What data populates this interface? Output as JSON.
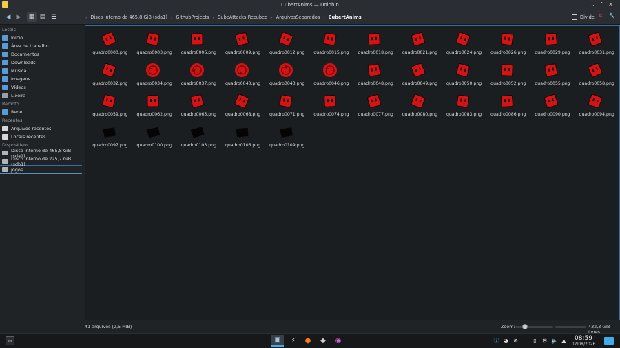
{
  "window": {
    "title": "CubertAnims — Dolphin"
  },
  "toolbar": {
    "back_icon": "arrow-left-icon",
    "forward_icon": "arrow-right-icon",
    "split_label": "Divide",
    "view_modes": [
      "icons-view",
      "compact-view",
      "details-view"
    ]
  },
  "breadcrumb": {
    "items": [
      "Disco interno de 465,8 GiB (sda1)",
      "GithubProjects",
      "CubeAttacks-Recubed",
      "ArquivosSeparados",
      "CubertAnims"
    ]
  },
  "sidebar": {
    "sections": [
      {
        "header": "Locais",
        "items": [
          {
            "label": "Início",
            "icon": "home-folder-icon"
          },
          {
            "label": "Área de trabalho",
            "icon": "desktop-folder-icon"
          },
          {
            "label": "Documentos",
            "icon": "documents-folder-icon"
          },
          {
            "label": "Downloads",
            "icon": "downloads-folder-icon"
          },
          {
            "label": "Música",
            "icon": "music-folder-icon"
          },
          {
            "label": "Imagens",
            "icon": "pictures-folder-icon"
          },
          {
            "label": "Vídeos",
            "icon": "videos-folder-icon"
          },
          {
            "label": "Lixeira",
            "icon": "trash-icon"
          }
        ]
      },
      {
        "header": "Remoto",
        "items": [
          {
            "label": "Rede",
            "icon": "network-icon"
          }
        ]
      },
      {
        "header": "Recentes",
        "items": [
          {
            "label": "Arquivos recentes",
            "icon": "recent-files-icon"
          },
          {
            "label": "Locais recentes",
            "icon": "recent-places-icon"
          }
        ]
      },
      {
        "header": "Dispositivos",
        "items": [
          {
            "label": "Disco interno de 465,8 GiB (sda1)",
            "icon": "drive-icon"
          },
          {
            "label": "Disco interno de 225,7 GiB (sdb1)",
            "icon": "drive-icon"
          },
          {
            "label": "jogos",
            "icon": "drive-icon"
          }
        ]
      }
    ]
  },
  "files": [
    {
      "name": "quadro0000.png",
      "kind": "red"
    },
    {
      "name": "quadro0003.png",
      "kind": "red"
    },
    {
      "name": "quadro0006.png",
      "kind": "red"
    },
    {
      "name": "quadro0009.png",
      "kind": "red"
    },
    {
      "name": "quadro0012.png",
      "kind": "red"
    },
    {
      "name": "quadro0015.png",
      "kind": "red"
    },
    {
      "name": "quadro0018.png",
      "kind": "red"
    },
    {
      "name": "quadro0021.png",
      "kind": "red"
    },
    {
      "name": "quadro0024.png",
      "kind": "red"
    },
    {
      "name": "quadro0026.png",
      "kind": "red"
    },
    {
      "name": "quadro0029.png",
      "kind": "red"
    },
    {
      "name": "quadro0031.png",
      "kind": "red"
    },
    {
      "name": "quadro0032.png",
      "kind": "red"
    },
    {
      "name": "quadro0034.png",
      "kind": "red-swirl"
    },
    {
      "name": "quadro0037.png",
      "kind": "red-swirl"
    },
    {
      "name": "quadro0040.png",
      "kind": "red-swirl"
    },
    {
      "name": "quadro0043.png",
      "kind": "red-swirl"
    },
    {
      "name": "quadro0046.png",
      "kind": "red-swirl"
    },
    {
      "name": "quadro0048.png",
      "kind": "red"
    },
    {
      "name": "quadro0049.png",
      "kind": "red"
    },
    {
      "name": "quadro0050.png",
      "kind": "red"
    },
    {
      "name": "quadro0052.png",
      "kind": "red"
    },
    {
      "name": "quadro0055.png",
      "kind": "red"
    },
    {
      "name": "quadro0058.png",
      "kind": "red"
    },
    {
      "name": "quadro0059.png",
      "kind": "red"
    },
    {
      "name": "quadro0062.png",
      "kind": "red"
    },
    {
      "name": "quadro0065.png",
      "kind": "red"
    },
    {
      "name": "quadro0068.png",
      "kind": "red"
    },
    {
      "name": "quadro0071.png",
      "kind": "red"
    },
    {
      "name": "quadro0074.png",
      "kind": "red"
    },
    {
      "name": "quadro0077.png",
      "kind": "red"
    },
    {
      "name": "quadro0080.png",
      "kind": "red"
    },
    {
      "name": "quadro0083.png",
      "kind": "red"
    },
    {
      "name": "quadro0086.png",
      "kind": "red"
    },
    {
      "name": "quadro0090.png",
      "kind": "red"
    },
    {
      "name": "quadro0094.png",
      "kind": "red"
    },
    {
      "name": "quadro0097.png",
      "kind": "black"
    },
    {
      "name": "quadro0100.png",
      "kind": "black"
    },
    {
      "name": "quadro0103.png",
      "kind": "black"
    },
    {
      "name": "quadro0106.png",
      "kind": "black"
    },
    {
      "name": "quadro0109.png",
      "kind": "black"
    }
  ],
  "status": {
    "summary": "41 arquivos (2,5 MiB)",
    "zoom_label": "Zoom:",
    "free_space": "432,3 GiB livres"
  },
  "taskbar": {
    "time": "08:59",
    "date": "02/08/2026",
    "apps": [
      "dolphin-icon",
      "kate-icon",
      "firefox-icon",
      "cube-app-icon",
      "color-app-icon"
    ],
    "tray": [
      "info-icon",
      "discord-icon",
      "steam-icon",
      "clipboard-icon",
      "network-icon",
      "volume-icon",
      "up-arrow-icon"
    ]
  },
  "colors": {
    "accent": "#3daee9",
    "thumb_red": "#d41414",
    "thumb_black": "#050505"
  }
}
